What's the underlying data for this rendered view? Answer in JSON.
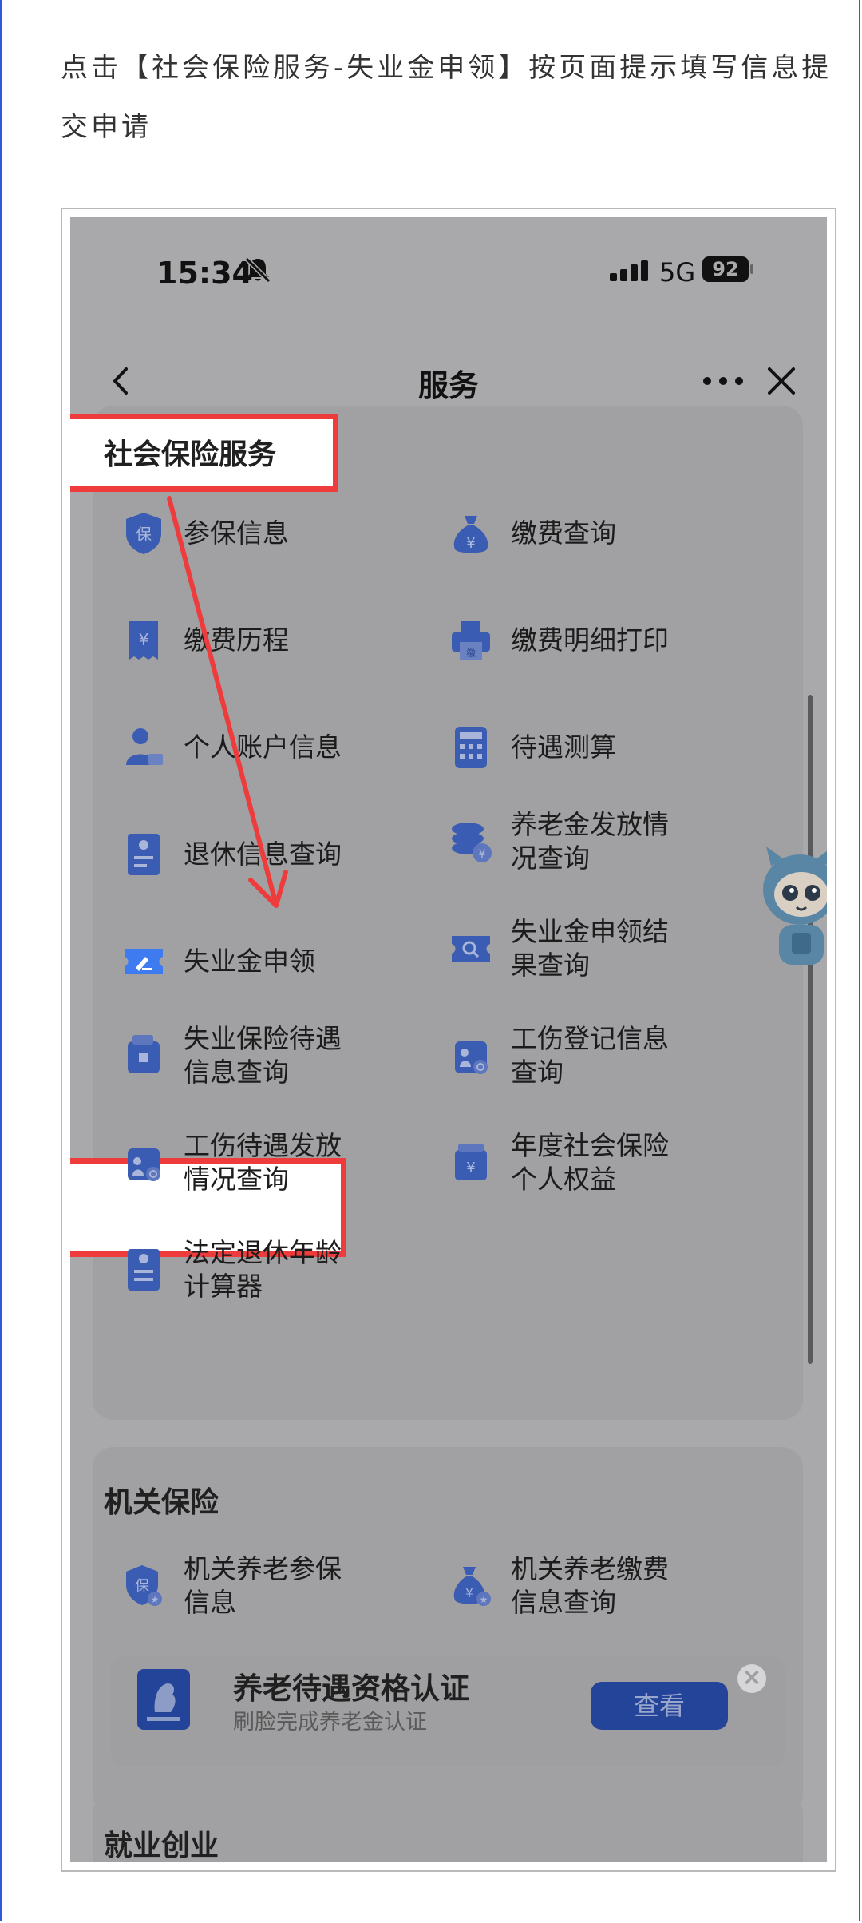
{
  "instruction": "点击【社会保险服务-失业金申领】按页面提示填写信息提交申请",
  "status_bar": {
    "time": "15:34",
    "network": "5G",
    "battery": "92"
  },
  "nav": {
    "title": "服务"
  },
  "social_insurance": {
    "title": "社会保险服务",
    "items": [
      {
        "label": "参保信息",
        "icon": "shield-insured-icon"
      },
      {
        "label": "缴费查询",
        "icon": "money-bag-icon"
      },
      {
        "label": "缴费历程",
        "icon": "receipt-icon"
      },
      {
        "label": "缴费明细打印",
        "icon": "printer-icon"
      },
      {
        "label": "个人账户信息",
        "icon": "person-card-icon"
      },
      {
        "label": "待遇测算",
        "icon": "calculator-icon"
      },
      {
        "label": "退休信息查询",
        "icon": "retirement-doc-icon"
      },
      {
        "label": "养老金发放情\n况查询",
        "icon": "coin-stack-icon"
      },
      {
        "label": "失业金申领",
        "icon": "ticket-pen-icon"
      },
      {
        "label": "失业金申领结\n果查询",
        "icon": "ticket-search-icon"
      },
      {
        "label": "失业保险待遇\n信息查询",
        "icon": "wallet-doc-icon"
      },
      {
        "label": "工伤登记信息\n查询",
        "icon": "injury-register-icon"
      },
      {
        "label": "工伤待遇发放\n情况查询",
        "icon": "injury-wallet-icon"
      },
      {
        "label": "年度社会保险\n个人权益",
        "icon": "yuan-box-icon"
      },
      {
        "label": "法定退休年龄\n计算器",
        "icon": "retirement-calc-icon"
      }
    ]
  },
  "government_insurance": {
    "title": "机关保险",
    "items": [
      {
        "label": "机关养老参保\n信息",
        "icon": "gov-shield-icon"
      },
      {
        "label": "机关养老缴费\n信息查询",
        "icon": "gov-money-bag-icon"
      }
    ]
  },
  "banner": {
    "title": "养老待遇资格认证",
    "subtitle": "刷脸完成养老金认证",
    "button": "查看",
    "close": "×"
  },
  "employment": {
    "title": "就业创业"
  }
}
